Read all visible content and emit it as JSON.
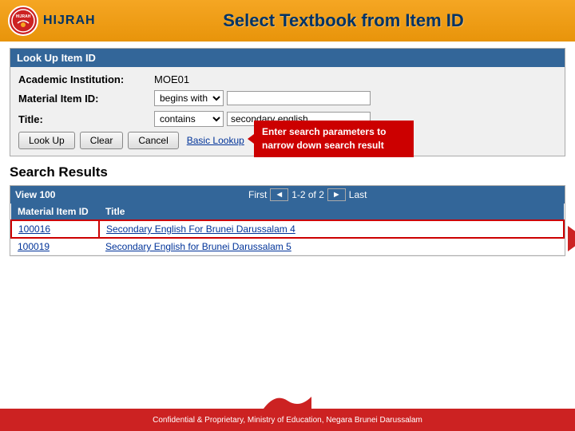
{
  "header": {
    "title": "Select Textbook from Item ID",
    "logo_text": "HIJRAH",
    "logo_tm": "™"
  },
  "lookup_section": {
    "header_label": "Look Up Item ID",
    "rows": [
      {
        "label": "Academic Institution:",
        "type": "value",
        "value": "MOE01"
      },
      {
        "label": "Material Item ID:",
        "type": "select_input",
        "select_value": "begins with",
        "input_value": ""
      },
      {
        "label": "Title:",
        "type": "select_input",
        "select_value": "contains",
        "input_value": "secondary english"
      }
    ],
    "buttons": {
      "look_up": "Look Up",
      "clear": "Clear",
      "cancel": "Cancel",
      "basic_lookup": "Basic Lookup"
    },
    "tooltip": "Enter search parameters to narrow down search result"
  },
  "results_section": {
    "title": "Search Results",
    "nav": {
      "view_label": "View 100",
      "first_label": "First",
      "prev_label": "◄",
      "page_info": "1-2 of 2",
      "next_label": "►",
      "last_label": "Last"
    },
    "columns": [
      "Material Item ID",
      "Title"
    ],
    "rows": [
      {
        "id": "100016",
        "title": "Secondary English For Brunei Darussalam 4",
        "highlighted": true
      },
      {
        "id": "100019",
        "title": "Secondary English for Brunei Darussalam 5",
        "highlighted": false
      }
    ]
  },
  "footer": {
    "text": "Confidential & Proprietary, Ministry of Education, Negara Brunei Darussalam"
  }
}
